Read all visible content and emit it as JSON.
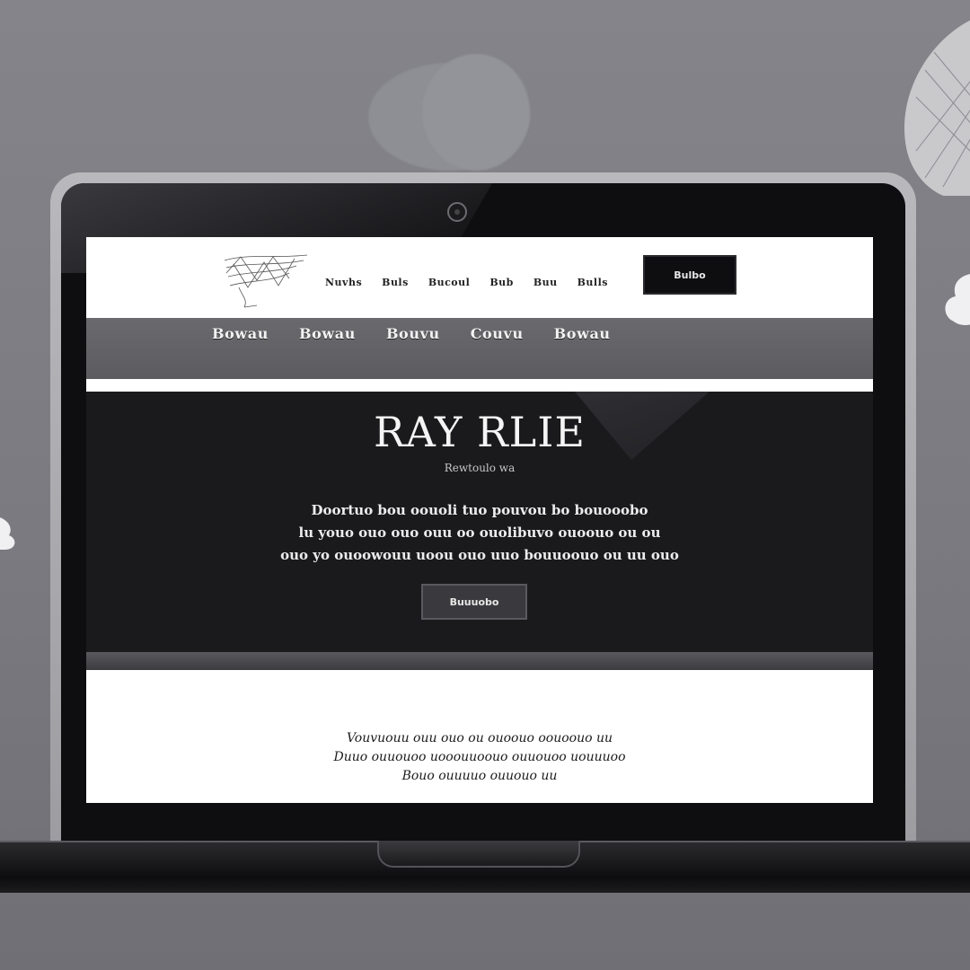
{
  "site": {
    "nav": [
      "Nuvhs",
      "Buls",
      "Bucoul",
      "Bub",
      "Buu",
      "Bulls"
    ],
    "header_button": "Bulbo",
    "subnav": [
      "Bowau",
      "Bowau",
      "Bouvu",
      "Couvu",
      "Bowau"
    ],
    "hero": {
      "title": "RAY RLIE",
      "subtitle": "Rewtoulo wa",
      "body_lines": [
        "Doortuo bou oouoli tuo pouvou bo bouooobo",
        "lu youo ouo ouo ouu oo ouolibuvo ouoouo ou ou",
        "ouo yo ouoowouu uoou ouo uuo bouuoouo ou uu ouo"
      ],
      "button": "Buuuobo"
    },
    "content_lines": [
      "Vouvuouu ouu ouo ou ouoouo oouoouo uu",
      "Duuo ouuouoo uooouuoouo ouuouoo uouuuoo",
      "Bouo ouuuuo ouuouo uu"
    ]
  },
  "colors": {
    "background": "#7b7b81",
    "hero": "#1a1a1d",
    "header_button": "#0e0e10"
  }
}
